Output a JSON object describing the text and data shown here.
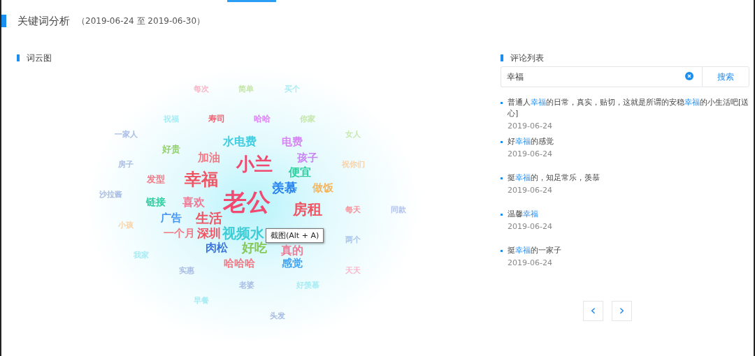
{
  "header": {
    "title": "关键词分析",
    "date_range": "（2019-06-24 至 2019-06-30）"
  },
  "word_cloud": {
    "title": "词云图",
    "words": [
      {
        "text": "每次",
        "color": "#f9b6c8"
      },
      {
        "text": "简单",
        "color": "#c4e6a8"
      },
      {
        "text": "买个",
        "color": "#a8ecf4"
      },
      {
        "text": "祝福",
        "color": "#a8ecf4"
      },
      {
        "text": "寿司",
        "color": "#f06474"
      },
      {
        "text": "哈哈",
        "color": "#d884f2"
      },
      {
        "text": "你家",
        "color": "#c4e6a8"
      },
      {
        "text": "一家人",
        "color": "#a8bce4"
      },
      {
        "text": "女人",
        "color": "#c8e8b0"
      },
      {
        "text": "好贵",
        "color": "#92d06e"
      },
      {
        "text": "水电费",
        "color": "#3ecde0"
      },
      {
        "text": "电费",
        "color": "#d884f2"
      },
      {
        "text": "加油",
        "color": "#f07a86"
      },
      {
        "text": "小兰",
        "color": "#f04a70"
      },
      {
        "text": "孩子",
        "color": "#c884f2"
      },
      {
        "text": "房子",
        "color": "#a8bce4"
      },
      {
        "text": "祝你们",
        "color": "#f8d2a8"
      },
      {
        "text": "发型",
        "color": "#f07a86"
      },
      {
        "text": "幸福",
        "color": "#f05462"
      },
      {
        "text": "便宜",
        "color": "#2ed0a0"
      },
      {
        "text": "羡慕",
        "color": "#2a84ee"
      },
      {
        "text": "做饭",
        "color": "#f8b458"
      },
      {
        "text": "沙拉酱",
        "color": "#a8bce4"
      },
      {
        "text": "链接",
        "color": "#2ed0a0"
      },
      {
        "text": "喜欢",
        "color": "#f07a96"
      },
      {
        "text": "老公",
        "color": "#f04a70"
      },
      {
        "text": "房租",
        "color": "#f05462"
      },
      {
        "text": "每天",
        "color": "#f89098"
      },
      {
        "text": "同款",
        "color": "#b4c4ec"
      },
      {
        "text": "小孩",
        "color": "#f8d2a8"
      },
      {
        "text": "广告",
        "color": "#4494f0"
      },
      {
        "text": "生活",
        "color": "#f05462"
      },
      {
        "text": "一个月",
        "color": "#f07a86"
      },
      {
        "text": "深圳",
        "color": "#f05462"
      },
      {
        "text": "视频水",
        "color": "#3ecdd6"
      },
      {
        "text": "两个",
        "color": "#a8c4ec"
      },
      {
        "text": "我家",
        "color": "#a8ecf4"
      },
      {
        "text": "肉松",
        "color": "#3a74e0"
      },
      {
        "text": "好吃",
        "color": "#86c858"
      },
      {
        "text": "真的",
        "color": "#f07a96"
      },
      {
        "text": "哈哈哈",
        "color": "#f07a86"
      },
      {
        "text": "感觉",
        "color": "#44a4f0"
      },
      {
        "text": "天天",
        "color": "#f9b6c8"
      },
      {
        "text": "实惠",
        "color": "#a8bce4"
      },
      {
        "text": "老婆",
        "color": "#a8bce4"
      },
      {
        "text": "好羡慕",
        "color": "#a8ecf4"
      },
      {
        "text": "早餐",
        "color": "#a8ecf4"
      },
      {
        "text": "头发",
        "color": "#a8bce4"
      }
    ],
    "tooltip": "截图(Alt + A)"
  },
  "comments": {
    "title": "评论列表",
    "search": {
      "value": "幸福",
      "button": "搜索"
    },
    "items": [
      {
        "text": "普通人**幸福**的日常，真实，贴切，这就是所谓的安稳**幸福**的小生活吧[送心]",
        "date": "2019-06-24"
      },
      {
        "text": "好**幸福**的感觉",
        "date": "2019-06-24"
      },
      {
        "text": "挺**幸福**的，知足常乐，羡慕",
        "date": "2019-06-24"
      },
      {
        "text": "温馨**幸福**",
        "date": "2019-06-24"
      },
      {
        "text": "挺**幸福**的一家子",
        "date": "2019-06-24"
      }
    ],
    "pager": {
      "prev": "‹",
      "next": "›"
    }
  }
}
